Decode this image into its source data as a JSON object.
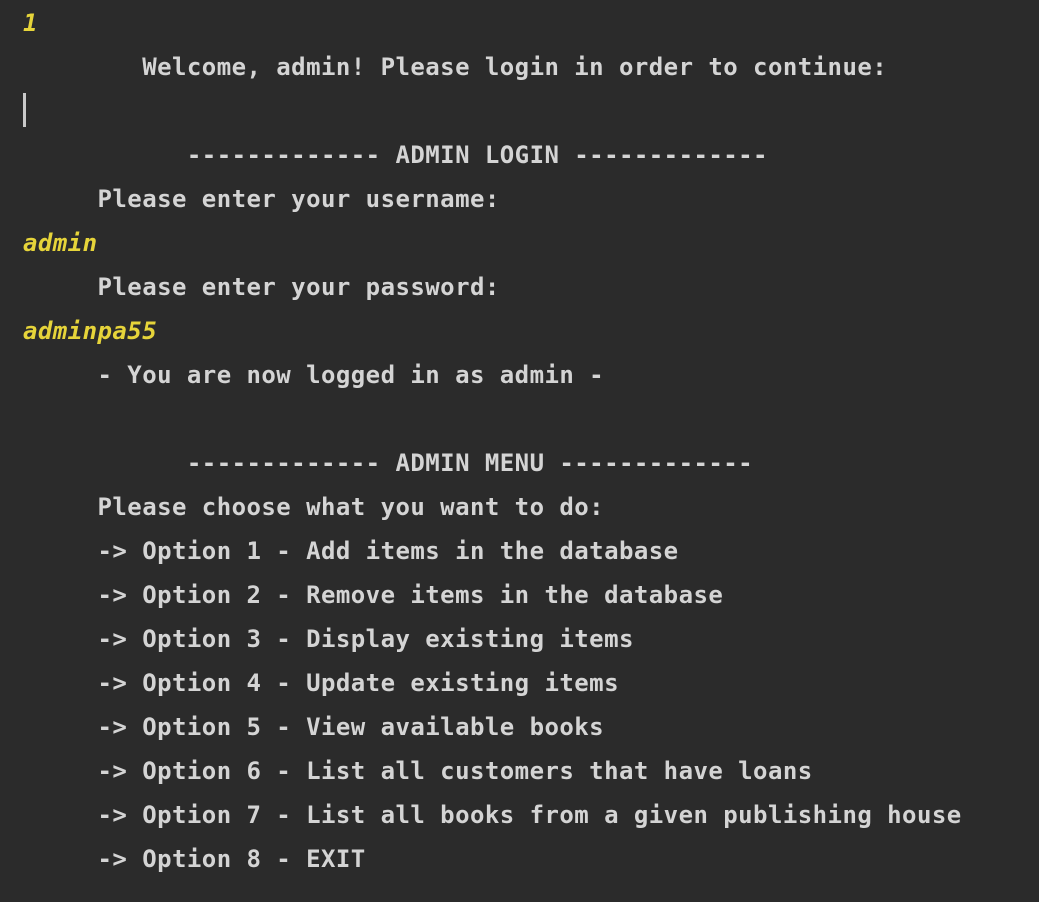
{
  "console": {
    "input_1": "1",
    "welcome": "        Welcome, admin! Please login in order to continue:",
    "login_header": "           ------------- ADMIN LOGIN -------------",
    "username_prompt": "     Please enter your username:",
    "username_value": "admin",
    "password_prompt": "     Please enter your password:",
    "password_value": "adminpa55",
    "logged_in_msg": "     - You are now logged in as admin -",
    "menu_header": "           ------------- ADMIN MENU -------------",
    "menu_prompt": "     Please choose what you want to do:",
    "options": [
      "     -> Option 1 - Add items in the database",
      "     -> Option 2 - Remove items in the database",
      "     -> Option 3 - Display existing items",
      "     -> Option 4 - Update existing items",
      "     -> Option 5 - View available books",
      "     -> Option 6 - List all customers that have loans",
      "     -> Option 7 - List all books from a given publishing house",
      "     -> Option 8 - EXIT"
    ]
  },
  "colors": {
    "background": "#2b2b2b",
    "output_text": "#d4d4d4",
    "user_input_text": "#e6d43a"
  }
}
